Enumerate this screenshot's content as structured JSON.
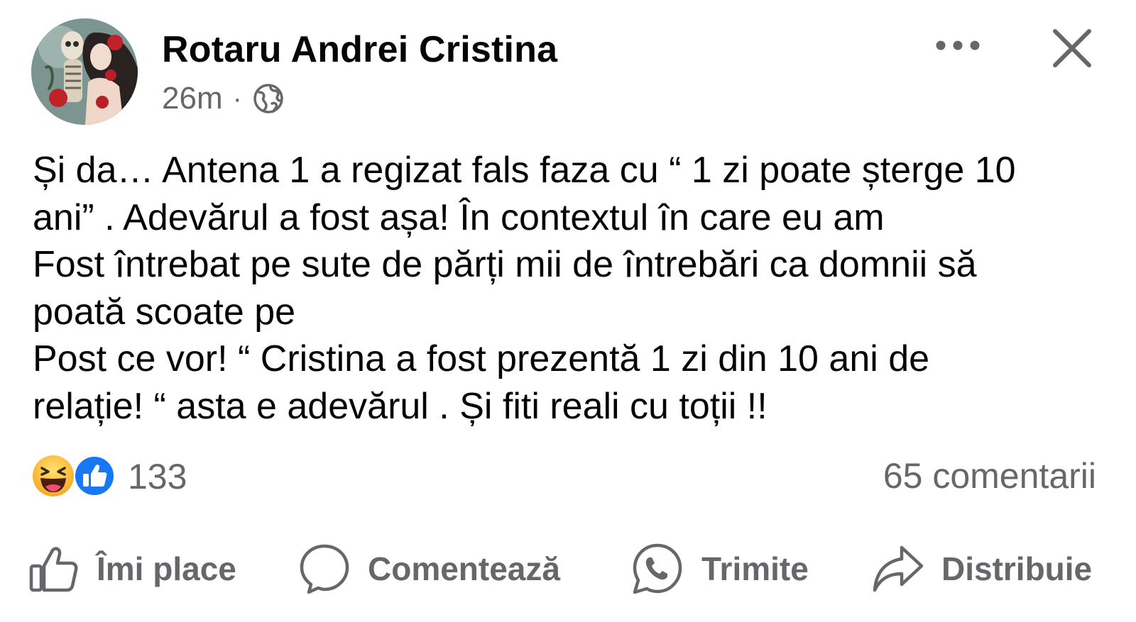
{
  "post": {
    "author": {
      "name": "Rotaru Andrei Cristina",
      "avatar_icon": "avatar-image"
    },
    "timestamp": "26m",
    "separator": "·",
    "privacy_icon": "globe-icon",
    "more_icon": "more-options-icon",
    "close_icon": "close-icon",
    "text_lines": [
      "Și da… Antena 1 a regizat fals faza cu “ 1 zi poate șterge 10",
      "ani” . Adevărul a fost așa! În contextul în care eu am",
      "Fost întrebat pe sute de părți mii de întrebări ca domnii să",
      "poată scoate pe",
      "Post ce vor! “ Cristina a fost prezentă 1 zi din 10 ani de",
      "relație! “ asta e adevărul . Și fiti reali cu toții !!"
    ],
    "reactions": {
      "icons": [
        "haha-reaction-icon",
        "like-reaction-icon"
      ],
      "count": "133",
      "like_color": "#1877f2",
      "haha_color": "#f7b125"
    },
    "comments_count": "65 comentarii"
  },
  "actions": {
    "like_label": "Îmi place",
    "comment_label": "Comentează",
    "send_label": "Trimite",
    "share_label": "Distribuie"
  },
  "colors": {
    "text_primary": "#050505",
    "text_secondary": "#65676b"
  }
}
